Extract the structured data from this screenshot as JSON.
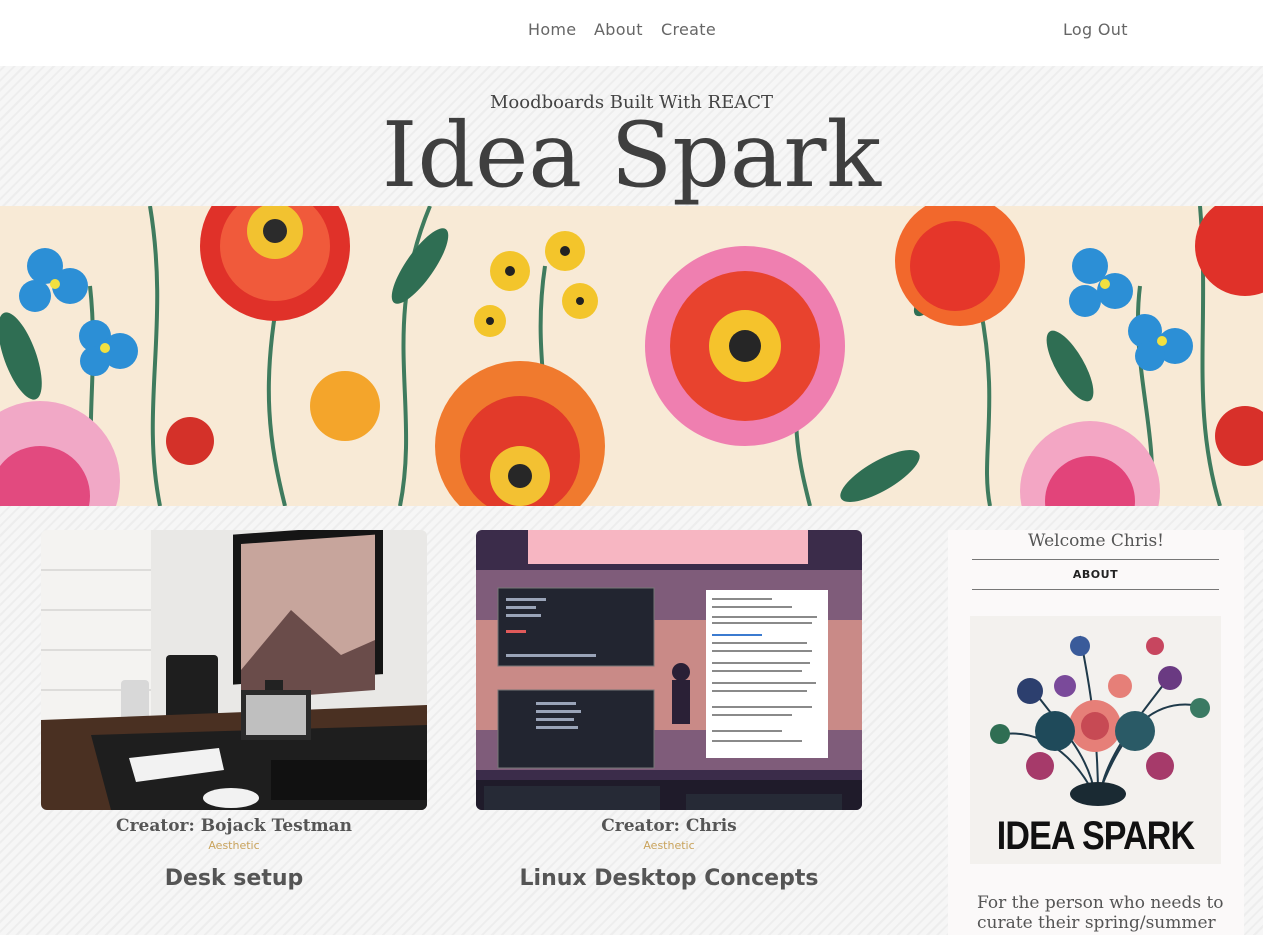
{
  "nav": {
    "home": "Home",
    "about": "About",
    "create": "Create",
    "logout": "Log Out"
  },
  "header": {
    "subtitle": "Moodboards Built With REACT",
    "title": "Idea Spark"
  },
  "cards": [
    {
      "creator": "Creator: Bojack Testman",
      "tag": "Aesthetic",
      "title": "Desk setup"
    },
    {
      "creator": "Creator: Chris",
      "tag": "Aesthetic",
      "title": "Linux Desktop Concepts"
    }
  ],
  "sidebar": {
    "welcome": "Welcome Chris!",
    "about": "ABOUT",
    "logo_text": "IDEA SPARK",
    "description": "For the person who needs to curate their spring/summer"
  },
  "colors": {
    "accent_tag": "#c9a35c",
    "text_dark": "#3f3f3f"
  }
}
